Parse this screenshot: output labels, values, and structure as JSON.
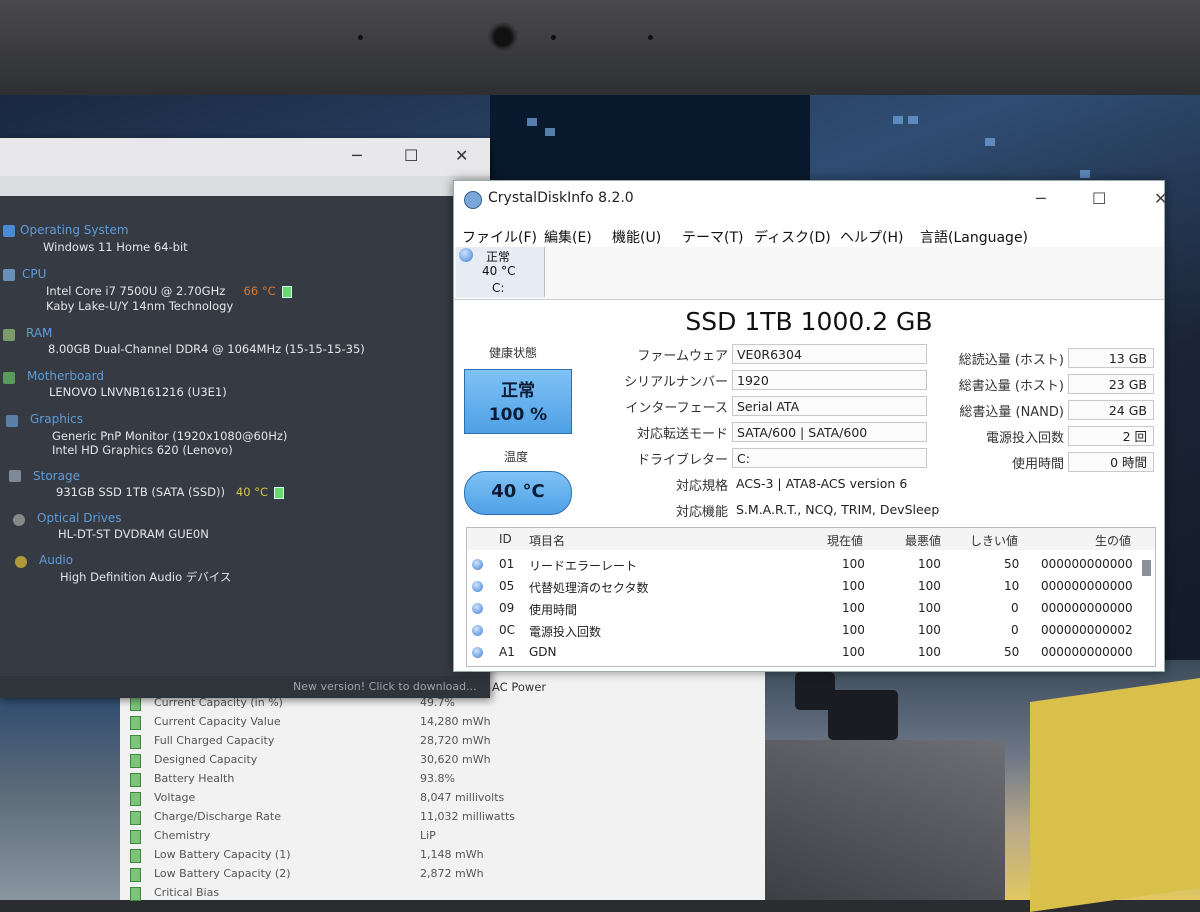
{
  "sysinfo": {
    "categories": [
      {
        "name": "Operating System",
        "lines": [
          "Windows 11 Home 64-bit"
        ]
      },
      {
        "name": "CPU",
        "lines": [
          "Intel Core i7 7500U @ 2.70GHz",
          "Kaby Lake-U/Y 14nm Technology"
        ],
        "temp": "66 °C"
      },
      {
        "name": "RAM",
        "lines": [
          "8.00GB Dual-Channel DDR4 @ 1064MHz (15-15-15-35)"
        ]
      },
      {
        "name": "Motherboard",
        "lines": [
          "LENOVO LNVNB161216 (U3E1)"
        ]
      },
      {
        "name": "Graphics",
        "lines": [
          "Generic PnP Monitor (1920x1080@60Hz)",
          "Intel HD Graphics 620 (Lenovo)"
        ]
      },
      {
        "name": "Storage",
        "lines": [
          "931GB SSD 1TB (SATA (SSD))"
        ],
        "temp": "40 °C"
      },
      {
        "name": "Optical Drives",
        "lines": [
          "HL-DT-ST DVDRAM GUE0N"
        ]
      },
      {
        "name": "Audio",
        "lines": [
          "High Definition Audio デバイス"
        ]
      }
    ],
    "footer": "New version! Click to download...",
    "colors": {
      "category": "#5f9cd9",
      "cpu_temp": "#e0782a",
      "storage_temp": "#d9c64a"
    }
  },
  "battery": {
    "ac": "AC Power",
    "rows": [
      {
        "k": "Current Capacity (in %)",
        "v": "49.7%"
      },
      {
        "k": "Current Capacity Value",
        "v": "14,280 mWh"
      },
      {
        "k": "Full Charged Capacity",
        "v": "28,720 mWh"
      },
      {
        "k": "Designed Capacity",
        "v": "30,620 mWh"
      },
      {
        "k": "Battery Health",
        "v": "93.8%"
      },
      {
        "k": "Voltage",
        "v": "8,047 millivolts"
      },
      {
        "k": "Charge/Discharge Rate",
        "v": "11,032 milliwatts"
      },
      {
        "k": "Chemistry",
        "v": "LiP"
      },
      {
        "k": "Low Battery Capacity (1)",
        "v": "1,148 mWh"
      },
      {
        "k": "Low Battery Capacity (2)",
        "v": "2,872 mWh"
      },
      {
        "k": "Critical Bias",
        "v": ""
      }
    ]
  },
  "cdi": {
    "title": "CrystalDiskInfo 8.2.0",
    "menu": [
      "ファイル(F)",
      "編集(E)",
      "機能(U)",
      "テーマ(T)",
      "ディスク(D)",
      "ヘルプ(H)",
      "言語(Language)"
    ],
    "disk_tab": {
      "status": "正常",
      "temp": "40 °C",
      "drive": "C:"
    },
    "model": "SSD 1TB 1000.2 GB",
    "health_label": "健康状態",
    "health_status": "正常",
    "health_percent": "100 %",
    "temp_label": "温度",
    "temp_value": "40 °C",
    "info": [
      {
        "k": "ファームウェア",
        "v": "VE0R6304"
      },
      {
        "k": "シリアルナンバー",
        "v": "1920"
      },
      {
        "k": "インターフェース",
        "v": "Serial ATA"
      },
      {
        "k": "対応転送モード",
        "v": "SATA/600 | SATA/600"
      },
      {
        "k": "ドライブレター",
        "v": "C:"
      },
      {
        "k": "対応規格",
        "v": "ACS-3 | ATA8-ACS version 6"
      },
      {
        "k": "対応機能",
        "v": "S.M.A.R.T., NCQ, TRIM, DevSleep"
      }
    ],
    "stats": [
      {
        "k": "総読込量 (ホスト)",
        "v": "13 GB"
      },
      {
        "k": "総書込量 (ホスト)",
        "v": "23 GB"
      },
      {
        "k": "総書込量 (NAND)",
        "v": "24 GB"
      },
      {
        "k": "電源投入回数",
        "v": "2 回"
      },
      {
        "k": "使用時間",
        "v": "0 時間"
      }
    ],
    "smart_headers": [
      "ID",
      "項目名",
      "現在値",
      "最悪値",
      "しきい値",
      "生の値"
    ],
    "smart_rows": [
      {
        "id": "01",
        "name": "リードエラーレート",
        "cur": "100",
        "worst": "100",
        "thr": "50",
        "raw": "000000000000"
      },
      {
        "id": "05",
        "name": "代替処理済のセクタ数",
        "cur": "100",
        "worst": "100",
        "thr": "10",
        "raw": "000000000000"
      },
      {
        "id": "09",
        "name": "使用時間",
        "cur": "100",
        "worst": "100",
        "thr": "0",
        "raw": "000000000000"
      },
      {
        "id": "0C",
        "name": "電源投入回数",
        "cur": "100",
        "worst": "100",
        "thr": "0",
        "raw": "000000000002"
      },
      {
        "id": "A1",
        "name": "GDN",
        "cur": "100",
        "worst": "100",
        "thr": "50",
        "raw": "000000000000"
      }
    ],
    "colors": {
      "status_good": "#4fa0e6"
    }
  }
}
